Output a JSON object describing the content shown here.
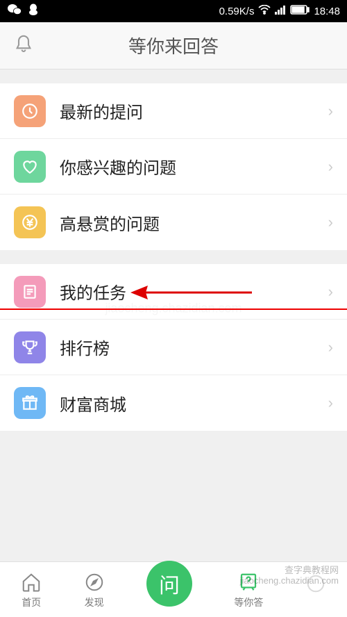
{
  "status_bar": {
    "speed": "0.59K/s",
    "time": "18:48"
  },
  "header": {
    "title": "等你来回答"
  },
  "menu_groups": [
    {
      "items": [
        {
          "key": "latest",
          "label": "最新的提问",
          "icon": "clock",
          "color": "orange"
        },
        {
          "key": "interested",
          "label": "你感兴趣的问题",
          "icon": "heart",
          "color": "green"
        },
        {
          "key": "bounty",
          "label": "高悬赏的问题",
          "icon": "yen",
          "color": "yellow"
        }
      ]
    },
    {
      "items": [
        {
          "key": "tasks",
          "label": "我的任务",
          "icon": "list",
          "color": "pink"
        },
        {
          "key": "ranking",
          "label": "排行榜",
          "icon": "trophy",
          "color": "purple"
        },
        {
          "key": "mall",
          "label": "财富商城",
          "icon": "gift",
          "color": "blue"
        }
      ]
    }
  ],
  "bottom_nav": {
    "items": [
      {
        "key": "home",
        "label": "首页"
      },
      {
        "key": "discover",
        "label": "发现"
      },
      {
        "key": "answer",
        "label": "等你答"
      }
    ],
    "center": "问"
  },
  "watermark": {
    "line1": "查字典教程网",
    "line2": "jiaocheng.chazidian.com"
  }
}
